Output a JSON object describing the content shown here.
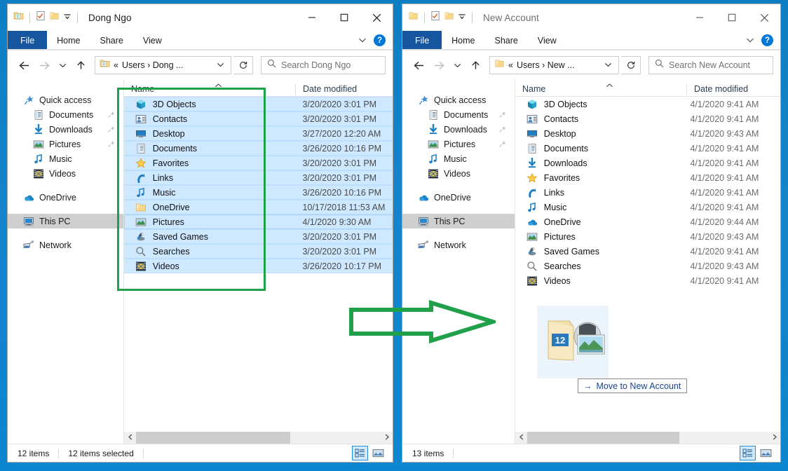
{
  "desktop": {
    "background_color": "#0d7ec4"
  },
  "windows": [
    {
      "id": "left",
      "title": "Dong Ngo",
      "active": true,
      "quick_access": [
        "folder-d-icon",
        "properties-icon",
        "new-folder-icon",
        "customize-qat-chevron-icon"
      ],
      "ribbon": {
        "file": "File",
        "tabs": [
          "Home",
          "Share",
          "View"
        ],
        "help": "?"
      },
      "nav": {
        "back": "back-arrow",
        "forward": "forward-arrow",
        "recent": "recent-chevron",
        "up": "up-arrow",
        "breadcrumb_prefix": "«",
        "breadcrumb": "Users  ›  Dong ...",
        "refresh": "refresh-icon",
        "search_placeholder": "Search Dong Ngo"
      },
      "sidebar": [
        {
          "label": "Quick access",
          "icon": "pin-star-icon",
          "indent": false,
          "pinned": false,
          "selected": false
        },
        {
          "label": "Documents",
          "icon": "documents-icon",
          "indent": true,
          "pinned": true,
          "selected": false
        },
        {
          "label": "Downloads",
          "icon": "downloads-icon",
          "indent": true,
          "pinned": true,
          "selected": false
        },
        {
          "label": "Pictures",
          "icon": "pictures-icon",
          "indent": true,
          "pinned": true,
          "selected": false
        },
        {
          "label": "Music",
          "icon": "music-icon",
          "indent": true,
          "pinned": false,
          "selected": false
        },
        {
          "label": "Videos",
          "icon": "videos-icon",
          "indent": true,
          "pinned": false,
          "selected": false
        },
        {
          "label": "OneDrive",
          "icon": "onedrive-cloud-icon",
          "indent": false,
          "pinned": false,
          "selected": false,
          "gap_before": true
        },
        {
          "label": "This PC",
          "icon": "this-pc-icon",
          "indent": false,
          "pinned": false,
          "selected": true,
          "gap_before": true
        },
        {
          "label": "Network",
          "icon": "network-icon",
          "indent": false,
          "pinned": false,
          "selected": false,
          "gap_before": true
        }
      ],
      "columns": {
        "name": "Name",
        "date": "Date modified",
        "sort": "ascending"
      },
      "files": [
        {
          "name": "3D Objects",
          "date": "3/20/2020 3:01 PM",
          "icon": "3d-objects-icon",
          "selected": true
        },
        {
          "name": "Contacts",
          "date": "3/20/2020 3:01 PM",
          "icon": "contacts-icon",
          "selected": true
        },
        {
          "name": "Desktop",
          "date": "3/27/2020 12:20 AM",
          "icon": "desktop-icon",
          "selected": true
        },
        {
          "name": "Documents",
          "date": "3/26/2020 10:16 PM",
          "icon": "documents-icon",
          "selected": true
        },
        {
          "name": "Favorites",
          "date": "3/20/2020 3:01 PM",
          "icon": "favorites-star-icon",
          "selected": true
        },
        {
          "name": "Links",
          "date": "3/20/2020 3:01 PM",
          "icon": "links-icon",
          "selected": true
        },
        {
          "name": "Music",
          "date": "3/26/2020 10:16 PM",
          "icon": "music-icon",
          "selected": true
        },
        {
          "name": "OneDrive",
          "date": "10/17/2018 11:53 AM",
          "icon": "folder-icon",
          "selected": true
        },
        {
          "name": "Pictures",
          "date": "4/1/2020 9:30 AM",
          "icon": "pictures-icon",
          "selected": true,
          "focused": true
        },
        {
          "name": "Saved Games",
          "date": "3/20/2020 3:01 PM",
          "icon": "saved-games-icon",
          "selected": true
        },
        {
          "name": "Searches",
          "date": "3/20/2020 3:01 PM",
          "icon": "searches-icon",
          "selected": true
        },
        {
          "name": "Videos",
          "date": "3/26/2020 10:17 PM",
          "icon": "videos-icon",
          "selected": true
        }
      ],
      "status": {
        "count": "12 items",
        "selection": "12 items selected"
      },
      "view_buttons": {
        "details": "details-view-icon",
        "large_icons": "large-icons-view-icon",
        "active": "details"
      }
    },
    {
      "id": "right",
      "title": "New Account",
      "active": false,
      "quick_access": [
        "folder-icon",
        "properties-icon",
        "new-folder-icon",
        "customize-qat-chevron-icon"
      ],
      "ribbon": {
        "file": "File",
        "tabs": [
          "Home",
          "Share",
          "View"
        ],
        "help": "?"
      },
      "nav": {
        "back": "back-arrow",
        "forward": "forward-arrow",
        "recent": "recent-chevron",
        "up": "up-arrow",
        "breadcrumb_prefix": "«",
        "breadcrumb": "Users  ›  New ...",
        "refresh": "refresh-icon",
        "search_placeholder": "Search New Account"
      },
      "sidebar": [
        {
          "label": "Quick access",
          "icon": "pin-star-icon",
          "indent": false,
          "pinned": false,
          "selected": false
        },
        {
          "label": "Documents",
          "icon": "documents-icon",
          "indent": true,
          "pinned": true,
          "selected": false
        },
        {
          "label": "Downloads",
          "icon": "downloads-icon",
          "indent": true,
          "pinned": true,
          "selected": false
        },
        {
          "label": "Pictures",
          "icon": "pictures-icon",
          "indent": true,
          "pinned": true,
          "selected": false
        },
        {
          "label": "Music",
          "icon": "music-icon",
          "indent": true,
          "pinned": false,
          "selected": false
        },
        {
          "label": "Videos",
          "icon": "videos-icon",
          "indent": true,
          "pinned": false,
          "selected": false
        },
        {
          "label": "OneDrive",
          "icon": "onedrive-cloud-icon",
          "indent": false,
          "pinned": false,
          "selected": false,
          "gap_before": true
        },
        {
          "label": "This PC",
          "icon": "this-pc-icon",
          "indent": false,
          "pinned": false,
          "selected": true,
          "gap_before": true
        },
        {
          "label": "Network",
          "icon": "network-icon",
          "indent": false,
          "pinned": false,
          "selected": false,
          "gap_before": true
        }
      ],
      "columns": {
        "name": "Name",
        "date": "Date modified",
        "sort": "ascending"
      },
      "files": [
        {
          "name": "3D Objects",
          "date": "4/1/2020 9:41 AM",
          "icon": "3d-objects-icon",
          "selected": false
        },
        {
          "name": "Contacts",
          "date": "4/1/2020 9:41 AM",
          "icon": "contacts-icon",
          "selected": false
        },
        {
          "name": "Desktop",
          "date": "4/1/2020 9:43 AM",
          "icon": "desktop-icon",
          "selected": false
        },
        {
          "name": "Documents",
          "date": "4/1/2020 9:41 AM",
          "icon": "documents-icon",
          "selected": false
        },
        {
          "name": "Downloads",
          "date": "4/1/2020 9:41 AM",
          "icon": "downloads-icon",
          "selected": false
        },
        {
          "name": "Favorites",
          "date": "4/1/2020 9:41 AM",
          "icon": "favorites-star-icon",
          "selected": false
        },
        {
          "name": "Links",
          "date": "4/1/2020 9:41 AM",
          "icon": "links-icon",
          "selected": false
        },
        {
          "name": "Music",
          "date": "4/1/2020 9:41 AM",
          "icon": "music-icon",
          "selected": false
        },
        {
          "name": "OneDrive",
          "date": "4/1/2020 9:44 AM",
          "icon": "onedrive-cloud-icon",
          "selected": false
        },
        {
          "name": "Pictures",
          "date": "4/1/2020 9:43 AM",
          "icon": "pictures-icon",
          "selected": false
        },
        {
          "name": "Saved Games",
          "date": "4/1/2020 9:41 AM",
          "icon": "saved-games-icon",
          "selected": false
        },
        {
          "name": "Searches",
          "date": "4/1/2020 9:43 AM",
          "icon": "searches-icon",
          "selected": false
        },
        {
          "name": "Videos",
          "date": "4/1/2020 9:41 AM",
          "icon": "videos-icon",
          "selected": false
        }
      ],
      "status": {
        "count": "13 items",
        "selection": ""
      },
      "view_buttons": {
        "details": "details-view-icon",
        "large_icons": "large-icons-view-icon",
        "active": "details"
      }
    }
  ],
  "drag": {
    "ghost_badge": "12",
    "tooltip_label": "Move to New Account",
    "tooltip_arrow": "→"
  },
  "annotations": {
    "highlight_color": "#21a04a",
    "selection_box_label": "selected-files-highlight",
    "arrow_label": "move-direction-arrow"
  }
}
